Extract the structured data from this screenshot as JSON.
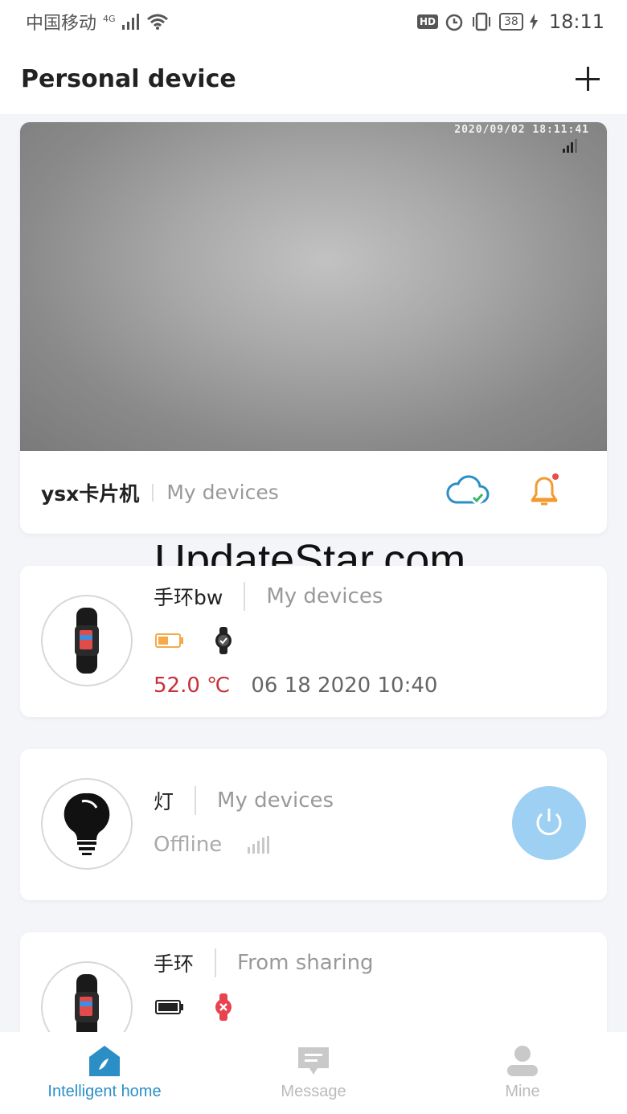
{
  "status_bar": {
    "carrier": "中国移动",
    "network": "4G",
    "hd": "HD",
    "battery": "38",
    "time": "18:11"
  },
  "header": {
    "title": "Personal device",
    "add_icon": "plus-icon"
  },
  "camera": {
    "timestamp": "2020/09/02 18:11:41",
    "name": "ysx卡片机",
    "group": "My devices",
    "cloud_icon": "cloud-check-icon",
    "bell_icon": "bell-icon",
    "accent_color": "#2b8fc6",
    "bell_color": "#f29a2e"
  },
  "watermark": "UpdateStar.com",
  "devices": [
    {
      "name": "手环bw",
      "group": "My devices",
      "temperature": "52.0 ℃",
      "datetime": "06 18 2020 10:40",
      "battery_color": "#f6a94a",
      "watch_icon": "watch-icon"
    },
    {
      "name": "灯",
      "group": "My devices",
      "status": "Offline",
      "power_icon": "power-icon"
    },
    {
      "name": "手环",
      "group": "From sharing",
      "battery_color": "#222222",
      "watch_icon": "watch-error-icon"
    }
  ],
  "nav": [
    {
      "label": "Intelligent home",
      "icon": "home-icon",
      "active": true
    },
    {
      "label": "Message",
      "icon": "message-icon",
      "active": false
    },
    {
      "label": "Mine",
      "icon": "user-icon",
      "active": false
    }
  ]
}
